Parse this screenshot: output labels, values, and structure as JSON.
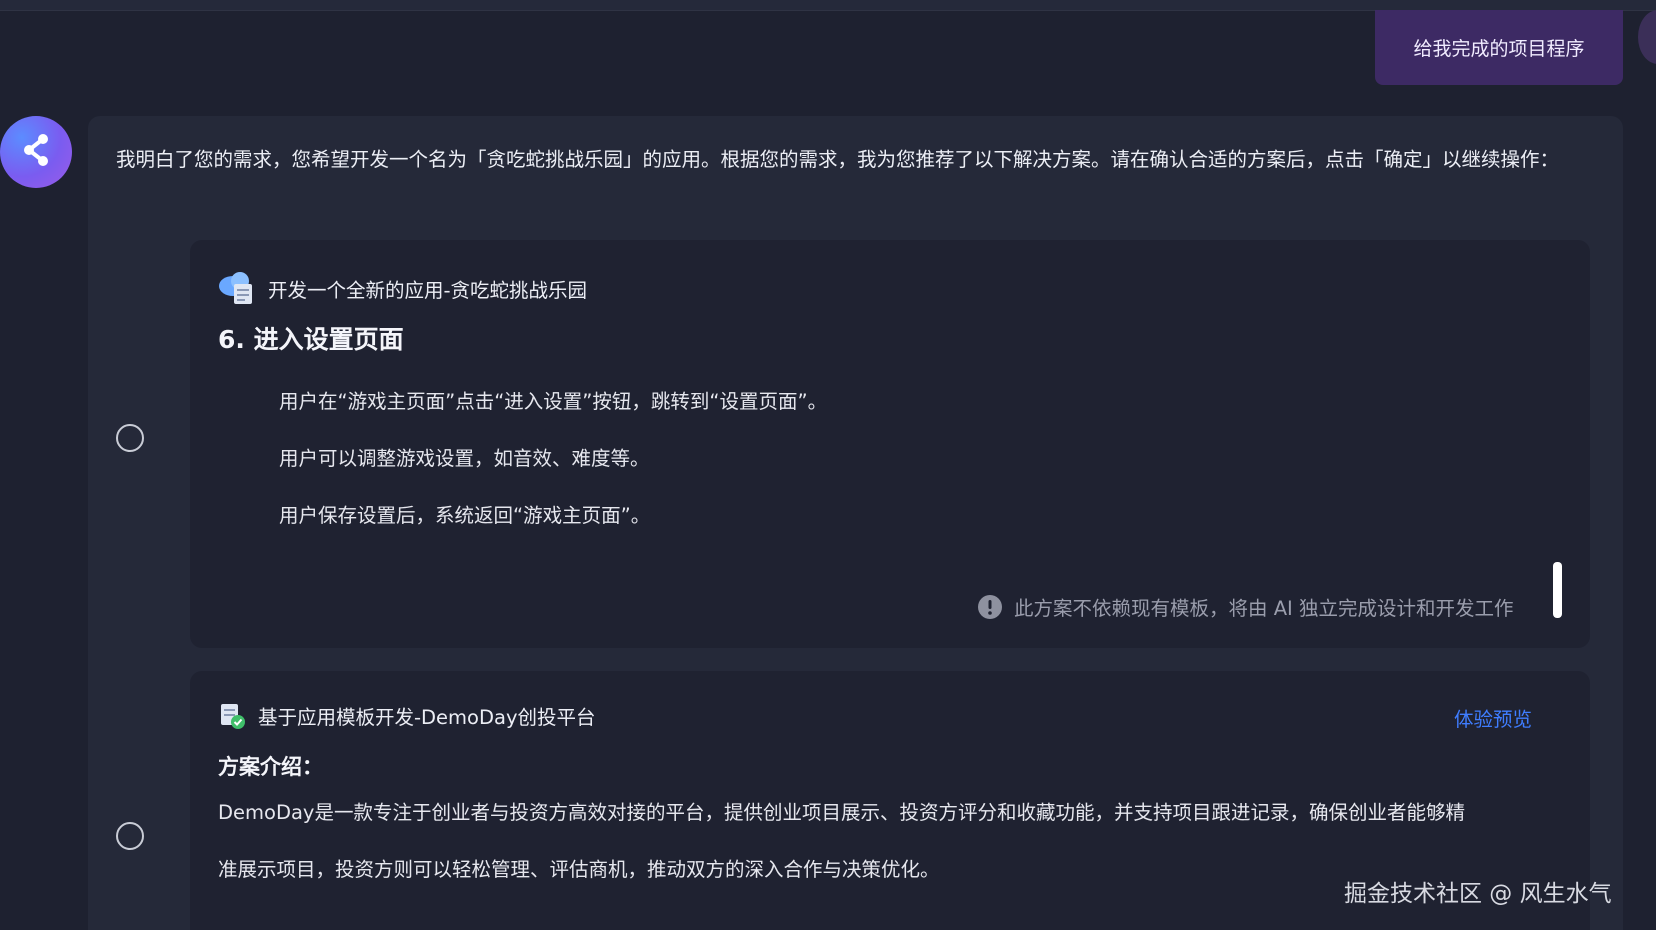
{
  "user_message": {
    "text": "给我完成的项目程序"
  },
  "assistant": {
    "avatar_icon": "share-icon",
    "intro": "我明白了您的需求，您希望开发一个名为「贪吃蛇挑战乐园」的应用。根据您的需求，我为您推荐了以下解决方案。请在确认合适的方案后，点击「确定」以继续操作："
  },
  "solutions": [
    {
      "header": "开发一个全新的应用-贪吃蛇挑战乐园",
      "header_icon": "cloud-document-icon",
      "section_heading": "6. 进入设置页面",
      "bullets": [
        "用户在“游戏主页面”点击“进入设置”按钮，跳转到“设置页面”。",
        "用户可以调整游戏设置，如音效、难度等。",
        "用户保存设置后，系统返回“游戏主页面”。"
      ],
      "notice_icon": "warning-icon",
      "notice": "此方案不依赖现有模板，将由 AI 独立完成设计和开发工作"
    },
    {
      "header": "基于应用模板开发-DemoDay创投平台",
      "header_icon": "template-document-icon",
      "preview_link": "体验预览",
      "intro_label": "方案介绍：",
      "description_lines": [
        "DemoDay是一款专注于创业者与投资方高效对接的平台，提供创业项目展示、投资方评分和收藏功能，并支持项目跟进记录，确保创业者能够精",
        "准展示项目，投资方则可以轻松管理、评估商机，推动双方的深入合作与决策优化。"
      ]
    }
  ],
  "watermark": "掘金技术社区 @ 风生水气",
  "colors": {
    "background": "#1e2130",
    "panel": "#252939",
    "card": "#1f2231",
    "user_bubble": "#3d2a64",
    "link": "#3f7dff",
    "muted": "#9a9dac"
  }
}
